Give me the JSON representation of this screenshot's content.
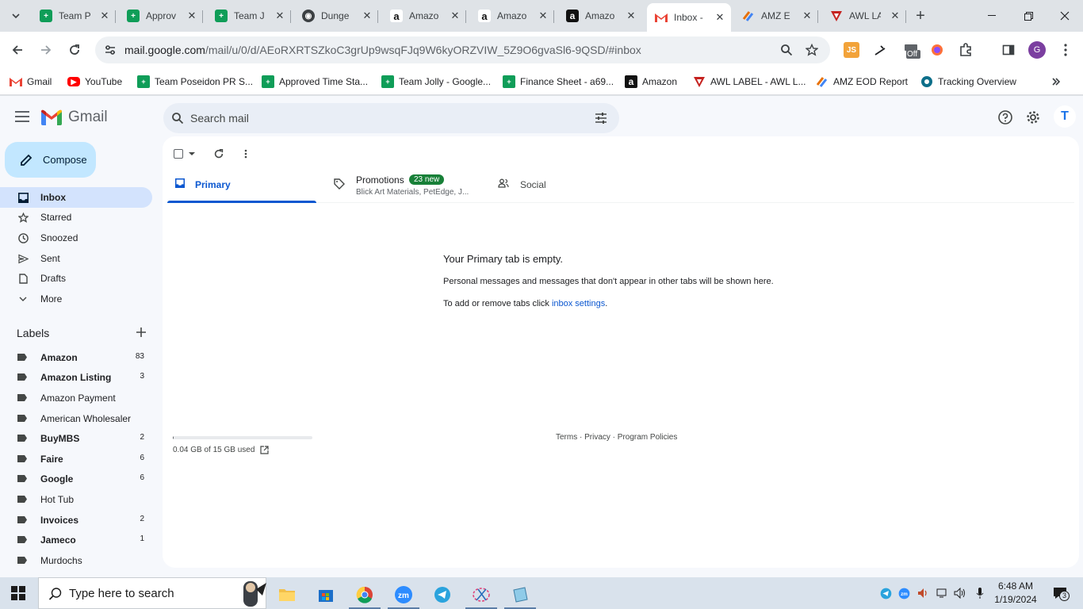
{
  "browser": {
    "tabs": [
      {
        "title": "Team P",
        "icon": "sheets-icon",
        "color": "#0f9d58"
      },
      {
        "title": "Approv",
        "icon": "sheets-icon",
        "color": "#0f9d58"
      },
      {
        "title": "Team J",
        "icon": "sheets-icon",
        "color": "#0f9d58"
      },
      {
        "title": "Dunge",
        "icon": "dungeon-icon",
        "color": "#3c4043"
      },
      {
        "title": "Amazo",
        "icon": "amazon-icon",
        "color": "#ffffff"
      },
      {
        "title": "Amazo",
        "icon": "amazon-icon",
        "color": "#ffffff"
      },
      {
        "title": "Amazo",
        "icon": "amazon-icon",
        "color": "#111111"
      },
      {
        "title": "Inbox -",
        "icon": "gmail-icon",
        "color": "#ea4335",
        "active": true
      },
      {
        "title": "AMZ E",
        "icon": "zoho-icon",
        "color": "#e8710a"
      },
      {
        "title": "AWL LA",
        "icon": "awl-icon",
        "color": "#c5221f"
      }
    ],
    "url_host": "mail.google.com",
    "url_path": "/mail/u/0/d/AEoRXRTSZkoC3grUp9wsqFJq9W6kyORZVIW_5Z9O6gvaSl6-9QSD/#inbox",
    "extensions": {
      "js_label": "JS",
      "off_label": "Off",
      "profile_initial": "G"
    },
    "bookmarks": [
      {
        "label": "Gmail",
        "icon": "gmail-icon"
      },
      {
        "label": "YouTube",
        "icon": "youtube-icon"
      },
      {
        "label": "Team Poseidon PR S...",
        "icon": "sheets-icon"
      },
      {
        "label": "Approved Time Sta...",
        "icon": "sheets-icon"
      },
      {
        "label": "Team Jolly - Google...",
        "icon": "sheets-icon"
      },
      {
        "label": "Finance Sheet - a69...",
        "icon": "sheets-icon"
      },
      {
        "label": "Amazon",
        "icon": "amazon-icon"
      },
      {
        "label": "AWL LABEL - AWL L...",
        "icon": "awl-icon"
      },
      {
        "label": "AMZ EOD Report",
        "icon": "zoho-icon"
      },
      {
        "label": "Tracking Overview",
        "icon": "tracking-icon"
      }
    ]
  },
  "gmail": {
    "logo_text": "Gmail",
    "search_placeholder": "Search mail",
    "avatar_initial": "T",
    "compose_label": "Compose",
    "nav": [
      {
        "label": "Inbox",
        "icon": "inbox-icon",
        "active": true
      },
      {
        "label": "Starred",
        "icon": "star-icon"
      },
      {
        "label": "Snoozed",
        "icon": "clock-icon"
      },
      {
        "label": "Sent",
        "icon": "send-icon"
      },
      {
        "label": "Drafts",
        "icon": "draft-icon"
      },
      {
        "label": "More",
        "icon": "chevron-down-icon"
      }
    ],
    "labels_heading": "Labels",
    "labels": [
      {
        "name": "Amazon",
        "count": "83",
        "bold": true
      },
      {
        "name": "Amazon Listing",
        "count": "3",
        "bold": true
      },
      {
        "name": "Amazon Payment",
        "count": "",
        "bold": false
      },
      {
        "name": "American Wholesaler",
        "count": "",
        "bold": false
      },
      {
        "name": "BuyMBS",
        "count": "2",
        "bold": true
      },
      {
        "name": "Faire",
        "count": "6",
        "bold": true
      },
      {
        "name": "Google",
        "count": "6",
        "bold": true
      },
      {
        "name": "Hot Tub",
        "count": "",
        "bold": false
      },
      {
        "name": "Invoices",
        "count": "2",
        "bold": true
      },
      {
        "name": "Jameco",
        "count": "1",
        "bold": true
      },
      {
        "name": "Murdochs",
        "count": "",
        "bold": false
      }
    ],
    "categories": {
      "primary": "Primary",
      "promotions": "Promotions",
      "promotions_badge": "23 new",
      "promotions_senders": "Blick Art Materials, PetEdge, J...",
      "social": "Social"
    },
    "empty": {
      "title": "Your Primary tab is empty.",
      "message": "Personal messages and messages that don't appear in other tabs will be shown here.",
      "tabs_prefix": "To add or remove tabs click ",
      "tabs_link": "inbox settings",
      "tabs_suffix": "."
    },
    "storage": {
      "text": "0.04 GB of 15 GB used",
      "used_fraction": 0.003
    },
    "footer": "Terms · Privacy · Program Policies"
  },
  "taskbar": {
    "search_placeholder": "Type here to search",
    "time": "6:48 AM",
    "date": "1/19/2024",
    "notification_count": "3"
  },
  "colors": {
    "accent": "#0b57d0",
    "compose_bg": "#c2e7ff",
    "active_nav": "#d3e3fd",
    "badge_green": "#188038"
  }
}
